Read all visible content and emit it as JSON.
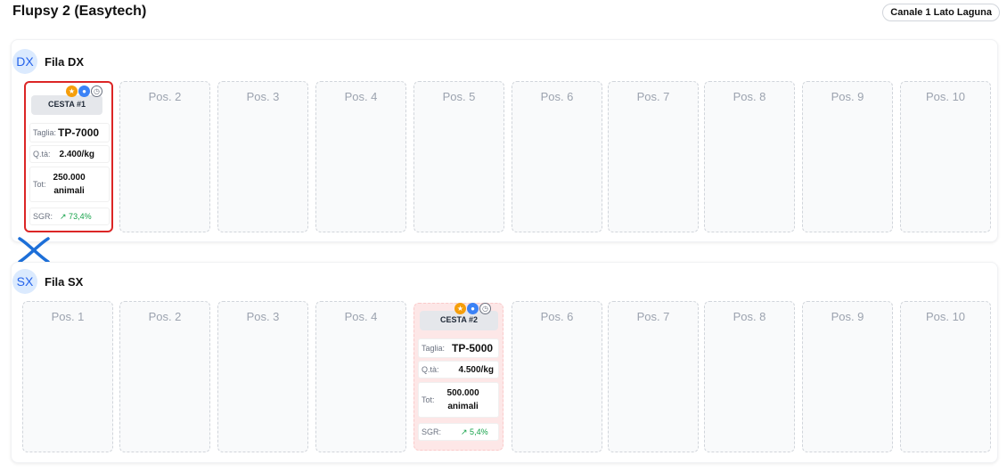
{
  "header": {
    "title": "Flupsy 2 (Easytech)",
    "badge": "Canale 1 Lato Laguna"
  },
  "rows": [
    {
      "code": "DX",
      "label": "Fila DX",
      "positions": [
        "",
        "Pos. 2",
        "Pos. 3",
        "Pos. 4",
        "Pos. 5",
        "Pos. 6",
        "Pos. 7",
        "Pos. 8",
        "Pos. 9",
        "Pos. 10"
      ]
    },
    {
      "code": "SX",
      "label": "Fila SX",
      "positions": [
        "Pos. 1",
        "Pos. 2",
        "Pos. 3",
        "Pos. 4",
        "",
        "Pos. 6",
        "Pos. 7",
        "Pos. 8",
        "Pos. 9",
        "Pos. 10"
      ]
    }
  ],
  "baskets": [
    {
      "name": "CESTA #1",
      "taglia_label": "Taglia:",
      "taglia": "TP-7000",
      "qta_label": "Q.tà:",
      "qta": "2.400/kg",
      "tot_label": "Tot:",
      "tot_line1": "250.000",
      "tot_line2": "animali",
      "sgr_label": "SGR:",
      "sgr": "↗ 73,4%"
    },
    {
      "name": "CESTA #2",
      "taglia_label": "Taglia:",
      "taglia": "TP-5000",
      "qta_label": "Q.tà:",
      "qta": "4.500/kg",
      "tot_label": "Tot:",
      "tot_line1": "500.000",
      "tot_line2": "animali",
      "sgr_label": "SGR:",
      "sgr": "↗ 5,4%"
    }
  ],
  "colors": {
    "selected_border": "#dc2626",
    "accent_blue": "#2563eb",
    "sgr_green": "#16a34a",
    "star": "#f59e0b"
  }
}
